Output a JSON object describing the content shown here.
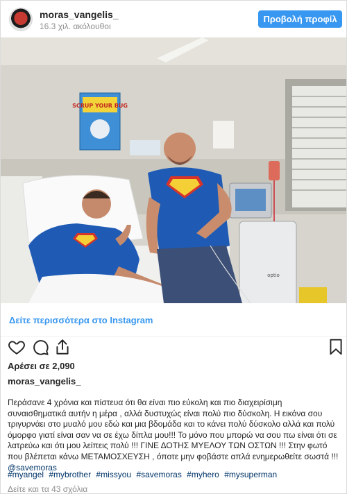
{
  "header": {
    "username": "moras_vangelis_",
    "followers": "16.3 χιλ. ακόλουθοι",
    "view_profile_label": "Προβολή προφίλ"
  },
  "photo": {
    "poster_text": "SCRUP YOUR BUG",
    "machine_brand": "optio"
  },
  "see_more": "Δείτε περισσότερα στο Instagram",
  "actions": {
    "icons": [
      "heart-icon",
      "comment-icon",
      "share-icon",
      "bookmark-icon"
    ]
  },
  "likes": "Αρέσει σε 2,090",
  "caption": {
    "username": "moras_vangelis_",
    "text": "Περάσανε 4 χρόνια και πίστευα ότι θα είναι πιο εύκολη και πιο διαχειρίσιμη συναισθηματικά αυτήν η μέρα , αλλά δυστυχώς είναι πολύ πιο δύσκολη. Η εικόνα σου τριγυρνάει στο μυαλό μου εδώ και μια βδομάδα και το κάνει πολύ δύσκολο αλλά και πολύ όμορφο γιατί είναι σαν να σε έχω δίπλα μου!!! Το μόνο που μπορώ να σου πω είναι ότι σε λατρεύω και ότι μου λείπεις πολύ !!! ΓΙΝΕ ΔΟΤΗΣ ΜΥΕΛΟΥ ΤΩΝ ΟΣΤΩΝ !!! Στην φωτό που βλέπεται κάνω ΜΕΤΑΜΟΣΧΕΥΣΗ , όποτε μην φοβάστε απλά ενημερωθείτε σωστά !!!",
    "mention": "@savemoras",
    "hashtags": [
      "#myangel",
      "#mybrother",
      "#missyou",
      "#savemoras",
      "#myhero",
      "#mysuperman"
    ]
  },
  "comments": "Δείτε και τα 43 σχόλια",
  "colors": {
    "accent": "#3897f0",
    "link": "#003569",
    "muted": "#8e8e8e",
    "text": "#262626",
    "border": "#dbdbdb"
  }
}
